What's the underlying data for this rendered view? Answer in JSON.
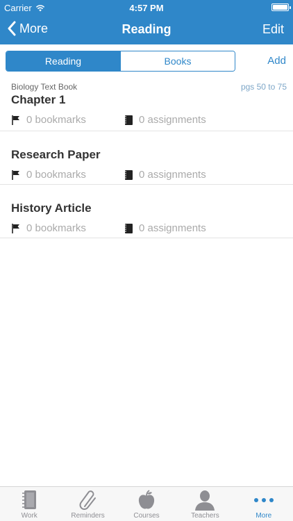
{
  "status": {
    "carrier": "Carrier",
    "time": "4:57 PM"
  },
  "nav": {
    "back_label": "More",
    "title": "Reading",
    "edit_label": "Edit"
  },
  "segments": {
    "reading": "Reading",
    "books": "Books",
    "add_label": "Add"
  },
  "items": [
    {
      "subtitle": "Biology Text Book",
      "pages": "pgs 50 to 75",
      "title": "Chapter 1",
      "bookmarks": "0 bookmarks",
      "assignments": "0 assignments"
    },
    {
      "title": "Research Paper",
      "bookmarks": "0 bookmarks",
      "assignments": "0 assignments"
    },
    {
      "title": "History Article",
      "bookmarks": "0 bookmarks",
      "assignments": "0 assignments"
    }
  ],
  "tabs": [
    {
      "label": "Work",
      "icon": "notebook-icon"
    },
    {
      "label": "Reminders",
      "icon": "paperclip-icon"
    },
    {
      "label": "Courses",
      "icon": "apple-icon"
    },
    {
      "label": "Teachers",
      "icon": "person-icon"
    },
    {
      "label": "More",
      "icon": "more-dots-icon",
      "active": true
    }
  ],
  "colors": {
    "accent": "#2f87c9",
    "muted_text": "#aaaaaa",
    "pages_text": "#7ea7c8"
  }
}
